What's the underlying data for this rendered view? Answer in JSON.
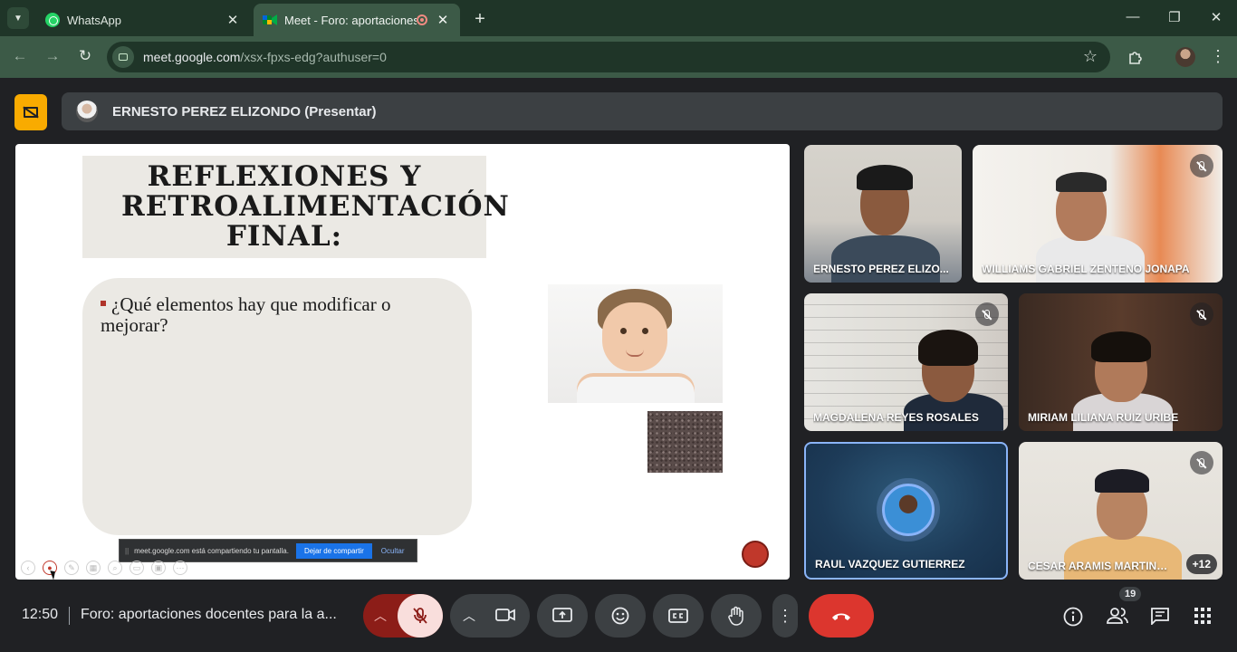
{
  "browser": {
    "tabs": [
      {
        "title": "WhatsApp"
      },
      {
        "title": "Meet - Foro: aportaciones d"
      }
    ],
    "url_host": "meet.google.com",
    "url_path": "/xsx-fpxs-edg?authuser=0"
  },
  "meet": {
    "presenter_banner": "ERNESTO PEREZ ELIZONDO (Presentar)",
    "slide": {
      "title": "REFLEXIONES Y RETROALIMENTACIÓN FINAL:",
      "bullet": "¿Qué elementos hay que modificar o mejorar?"
    },
    "share_notice": {
      "text": "meet.google.com está compartiendo tu pantalla.",
      "stop_label": "Dejar de compartir",
      "hide_label": "Ocultar"
    },
    "participants": [
      {
        "name": "ERNESTO PEREZ ELIZO...",
        "muted": false
      },
      {
        "name": "WILLIAMS GABRIEL ZENTENO JONAPA",
        "muted": true
      },
      {
        "name": "MAGDALENA REYES ROSALES",
        "muted": true
      },
      {
        "name": "MIRIAM LILIANA RUIZ URIBE",
        "muted": true
      },
      {
        "name": "RAUL VAZQUEZ GUTIERREZ",
        "muted": false
      },
      {
        "name": "CESAR ARAMIS MARTINEZ ...",
        "muted": true
      }
    ],
    "more_participants": "+12",
    "time": "12:50",
    "meeting_title": "Foro: aportaciones docentes para la a...",
    "people_count": "19"
  },
  "colors": {
    "tab_bar": "#1f3528",
    "address_bar": "#3c5a47",
    "meet_bg": "#202124",
    "present_icon": "#f9ab00",
    "end_call": "#dc362e",
    "mic_muted_bg": "#8c1d18",
    "active_speaker_border": "#8ab4f8"
  },
  "icons": {
    "tab_menu": "chevron-down-icon",
    "whatsapp": "whatsapp-icon",
    "meet": "meet-icon",
    "recording": "recording-icon",
    "new_tab": "plus-icon",
    "back": "back-arrow-icon",
    "forward": "forward-arrow-icon",
    "reload": "reload-icon",
    "bookmark": "star-icon",
    "extensions": "puzzle-icon",
    "info": "info-icon",
    "people": "people-icon",
    "chat": "chat-icon",
    "activities": "grid-icon"
  }
}
